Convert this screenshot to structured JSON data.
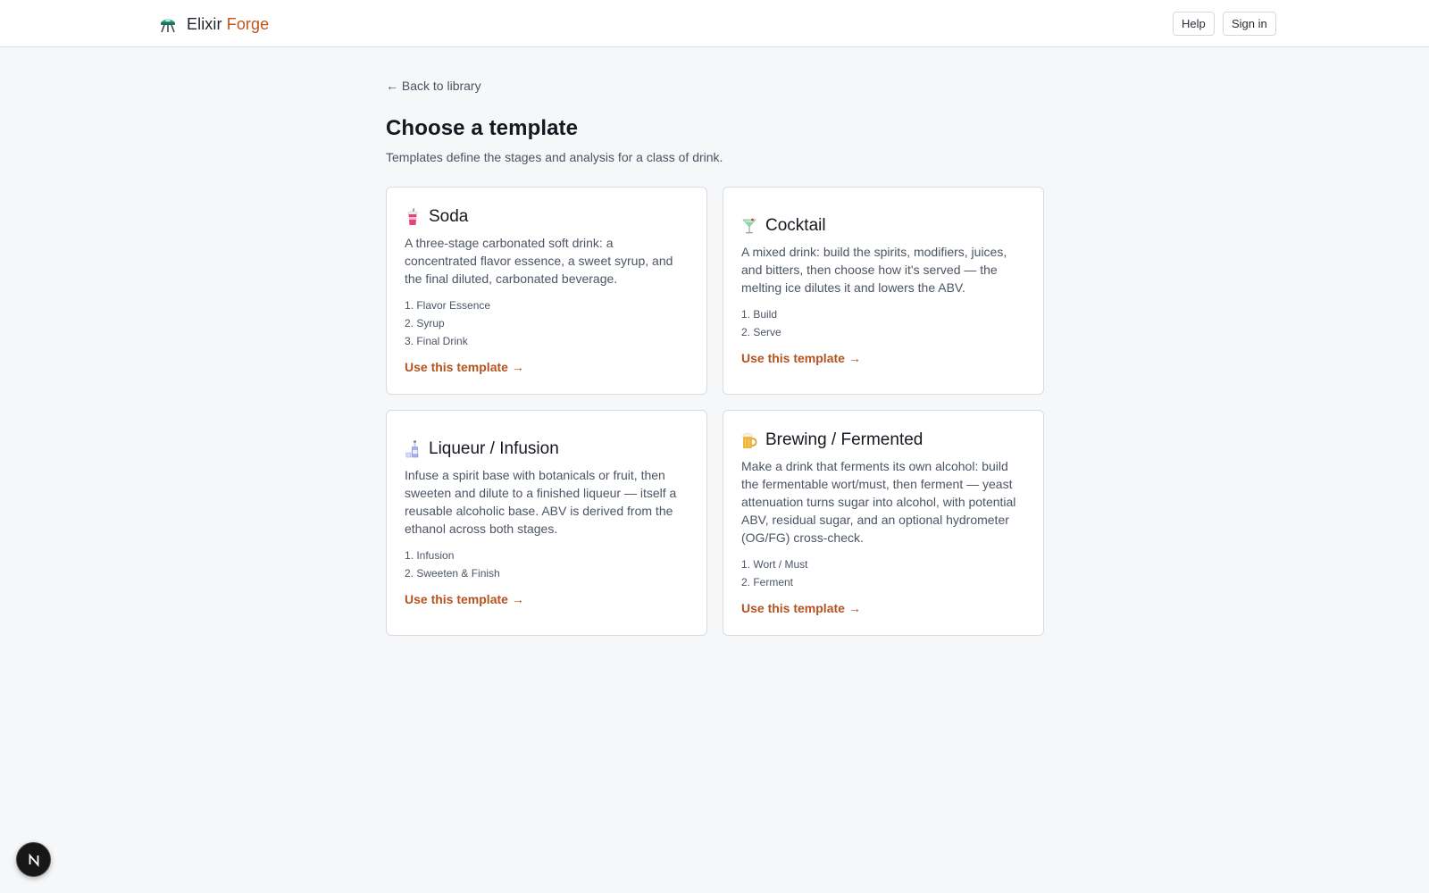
{
  "header": {
    "brand_primary": "Elixir",
    "brand_accent": "Forge",
    "help_label": "Help",
    "signin_label": "Sign in",
    "logo_icon": "flask-icon"
  },
  "main": {
    "back_label": "← Back to library",
    "title": "Choose a template",
    "subtitle": "Templates define the stages and analysis for a class of drink."
  },
  "templates": [
    {
      "icon": "soda-cup-icon",
      "title": "Soda",
      "description": "A three-stage carbonated soft drink: a concentrated flavor essence, a sweet syrup, and the final diluted, carbonated beverage.",
      "stages": [
        "1. Flavor Essence",
        "2. Syrup",
        "3. Final Drink"
      ],
      "cta": "Use this template →"
    },
    {
      "icon": "cocktail-glass-icon",
      "title": "Cocktail",
      "description": "A mixed drink: build the spirits, modifiers, juices, and bitters, then choose how it's served — the melting ice dilutes it and lowers the ABV.",
      "stages": [
        "1. Build",
        "2. Serve"
      ],
      "cta": "Use this template →"
    },
    {
      "icon": "bottle-icon",
      "title": "Liqueur / Infusion",
      "description": "Infuse a spirit base with botanicals or fruit, then sweeten and dilute to a finished liqueur — itself a reusable alcoholic base. ABV is derived from the ethanol across both stages.",
      "stages": [
        "1. Infusion",
        "2. Sweeten & Finish"
      ],
      "cta": "Use this template →"
    },
    {
      "icon": "beer-mug-icon",
      "title": "Brewing / Fermented",
      "description": "Make a drink that ferments its own alcohol: build the fermentable wort/must, then ferment — yeast attenuation turns sugar into alcohol, with potential ABV, residual sugar, and an optional hydrometer (OG/FG) cross-check.",
      "stages": [
        "1. Wort / Must",
        "2. Ferment"
      ],
      "cta": "Use this template →"
    }
  ],
  "colors": {
    "accent": "#c2531a",
    "link": "#b4531f",
    "background": "#f6f7f9",
    "card_border": "#d8dce2"
  }
}
